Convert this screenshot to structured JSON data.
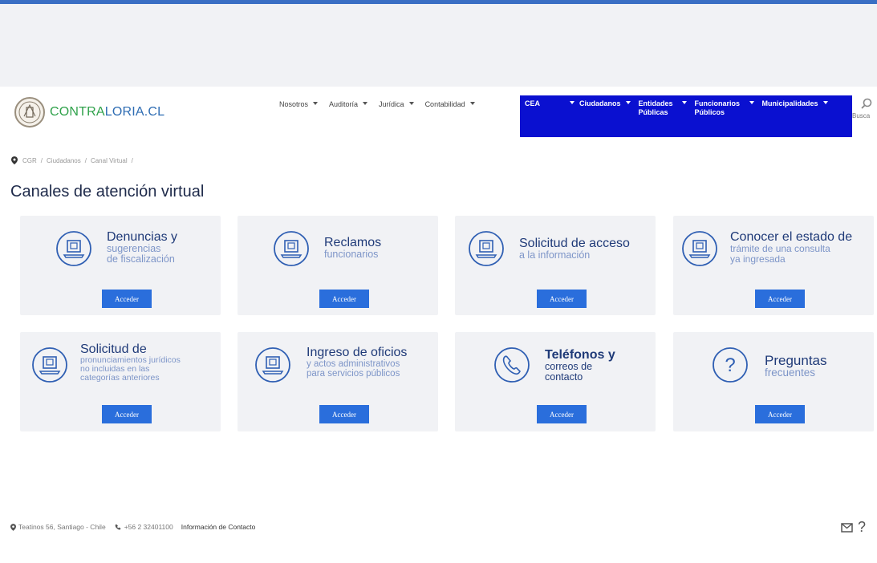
{
  "brand": {
    "logo_part_a": "CONTRA",
    "logo_part_b": "LORIA.CL",
    "color_green": "#2fa14a",
    "color_blue": "#2f6db3"
  },
  "nav": {
    "light_items": [
      {
        "label": "Nosotros"
      },
      {
        "label": "Auditoría"
      },
      {
        "label": "Jurídica"
      },
      {
        "label": "Contabilidad"
      }
    ],
    "dark_items": [
      {
        "label": "CEA"
      },
      {
        "label": "Ciudadanos"
      },
      {
        "label": "Entidades Públicas"
      },
      {
        "label": "Funcionarios Públicos"
      },
      {
        "label": "Municipalidades"
      }
    ],
    "accent_color": "#0a10d0",
    "search_label": "Busca"
  },
  "breadcrumb": [
    "CGR",
    "Ciudadanos",
    "Canal Virtual"
  ],
  "page_title": "Canales de atención virtual",
  "cards": [
    {
      "title": "Denuncias y",
      "sub": [
        "sugerencias",
        "de fiscalización"
      ],
      "icon": "computer-document-icon",
      "button": "Acceder"
    },
    {
      "title": "Reclamos",
      "sub": [
        "funcionarios"
      ],
      "icon": "computer-document-icon",
      "button": "Acceder"
    },
    {
      "title": "Solicitud de acceso",
      "sub": [
        "a la información"
      ],
      "icon": "computer-document-icon",
      "button": "Acceder"
    },
    {
      "title": "Conocer el estado de",
      "sub": [
        "trámite de una consulta",
        "ya ingresada"
      ],
      "icon": "computer-document-icon",
      "button": "Acceder"
    },
    {
      "title": "Solicitud de",
      "sub": [
        "pronunciamientos jurídicos",
        "no incluidas en las",
        "categorías anteriores"
      ],
      "icon": "computer-document-icon",
      "button": "Acceder"
    },
    {
      "title": "Ingreso de oficios",
      "sub": [
        "y actos administrativos",
        "para servicios públicos"
      ],
      "icon": "computer-document-icon",
      "button": "Acceder"
    },
    {
      "title": "Teléfonos y",
      "sub": [
        "correos de",
        "contacto"
      ],
      "icon": "phone-icon",
      "button": "Acceder"
    },
    {
      "title": "Preguntas",
      "sub": [
        "frecuentes"
      ],
      "icon": "question-icon",
      "button": "Acceder"
    }
  ],
  "footer": {
    "address": "Teatinos 56, Santiago - Chile",
    "phone": "+56 2 32401100",
    "contact_link": "Información de Contacto",
    "help_glyph": "?"
  },
  "colors": {
    "button": "#2a6edc",
    "card_bg": "#f1f2f5",
    "title": "#1f3a78",
    "subtitle": "#7d95c8"
  }
}
